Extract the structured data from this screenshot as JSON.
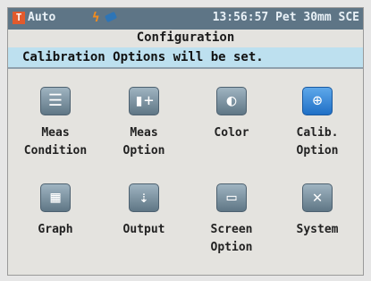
{
  "status": {
    "mode": "Auto",
    "mode_icon": "T",
    "time": "13:56:57",
    "info": "Pet 30mm SCE"
  },
  "header": {
    "title": "Configuration",
    "message": "Calibration Options will be set."
  },
  "menu": [
    {
      "line1": "Meas",
      "line2": "Condition",
      "icon": "settings-list-icon"
    },
    {
      "line1": "Meas",
      "line2": "Option",
      "icon": "add-option-icon"
    },
    {
      "line1": "Color",
      "line2": "",
      "icon": "color-sample-icon"
    },
    {
      "line1": "Calib.",
      "line2": "Option",
      "icon": "calibration-plus-icon"
    },
    {
      "line1": "Graph",
      "line2": "",
      "icon": "graph-icon"
    },
    {
      "line1": "Output",
      "line2": "",
      "icon": "usb-icon"
    },
    {
      "line1": "Screen",
      "line2": "Option",
      "icon": "screen-icon"
    },
    {
      "line1": "System",
      "line2": "",
      "icon": "wrench-screwdriver-icon"
    }
  ]
}
